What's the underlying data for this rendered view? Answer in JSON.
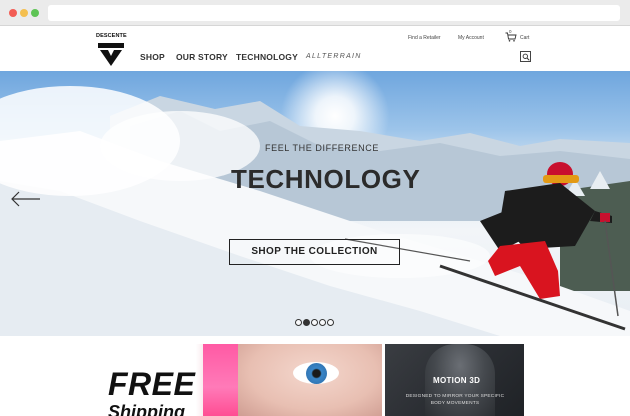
{
  "header": {
    "logo_text": "DESCENTE",
    "nav": {
      "shop": "SHOP",
      "our_story": "OUR STORY",
      "technology": "TECHNOLOGY",
      "allterrain": "ALLTERRAIN"
    },
    "utility": {
      "find_retailer": "Find a Retailer",
      "my_account": "My Account",
      "cart_label": "Cart",
      "cart_count": "0"
    }
  },
  "hero": {
    "eyebrow": "FEEL THE DIFFERENCE",
    "headline": "TECHNOLOGY",
    "cta": "SHOP THE COLLECTION",
    "slides_total": 5,
    "active_slide": 2
  },
  "promos": {
    "left": {
      "title": "FREE",
      "subtitle": "Shipping"
    },
    "right": {
      "title": "MOTION 3D",
      "subtitle": "DESIGNED TO MIRROR YOUR SPECIFIC BODY MOVEMENTS"
    }
  },
  "colors": {
    "brand_text": "#2b2b2b",
    "accent_pink": "#ff5aa4"
  }
}
